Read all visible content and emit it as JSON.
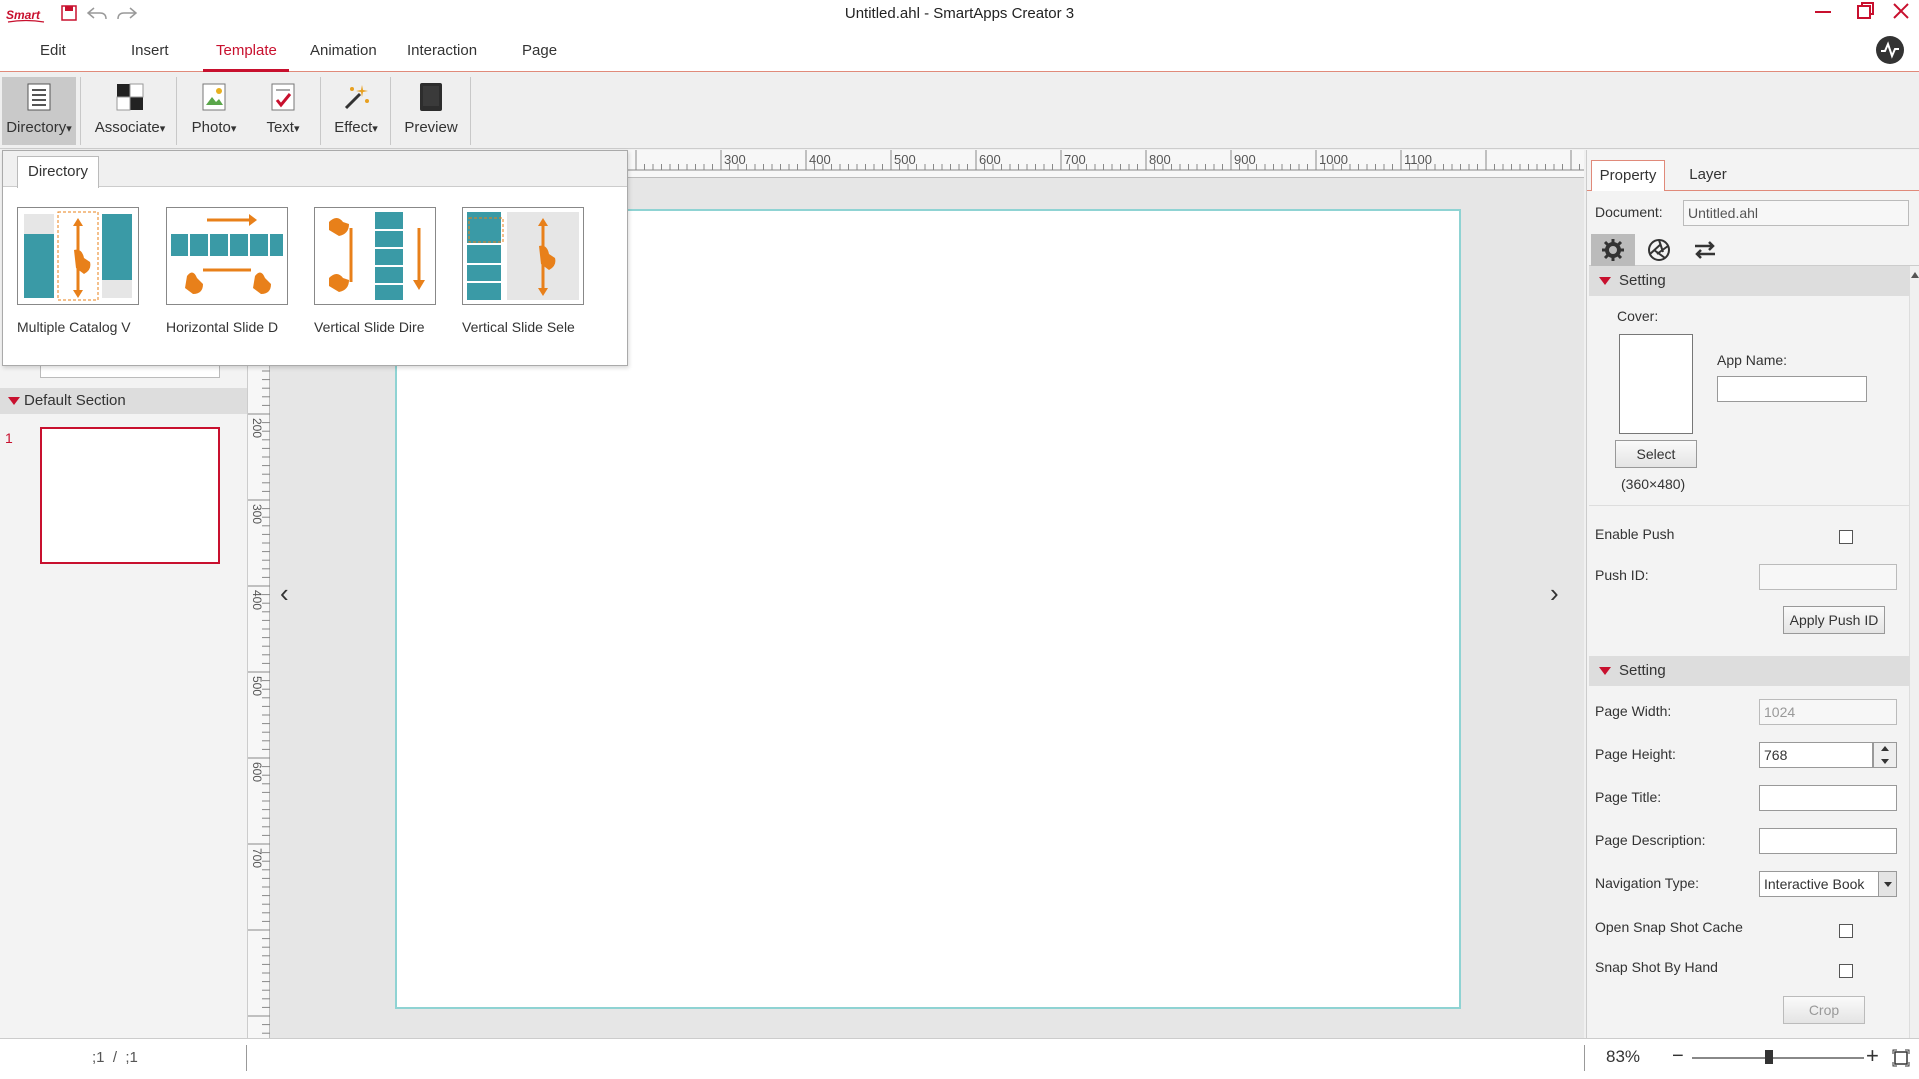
{
  "window": {
    "title": "Untitled.ahl - SmartApps Creator 3",
    "logo": "Smart"
  },
  "menu": {
    "items": [
      "Edit",
      "Insert",
      "Template",
      "Animation",
      "Interaction",
      "Page"
    ],
    "active": "Template"
  },
  "ribbon": {
    "buttons": [
      {
        "label": "Directory",
        "has_dropdown": true,
        "icon": "directory-icon"
      },
      {
        "label": "Associate",
        "has_dropdown": true,
        "icon": "associate-icon"
      },
      {
        "label": "Photo",
        "has_dropdown": true,
        "icon": "photo-icon"
      },
      {
        "label": "Text",
        "has_dropdown": true,
        "icon": "text-icon"
      },
      {
        "label": "Effect",
        "has_dropdown": true,
        "icon": "magic-wand-icon"
      },
      {
        "label": "Preview",
        "has_dropdown": false,
        "icon": "preview-icon"
      }
    ],
    "dropdown_glyph": "▾"
  },
  "directory_popup": {
    "tab": "Directory",
    "templates": [
      {
        "caption": "Multiple Catalog V"
      },
      {
        "caption": "Horizontal Slide D"
      },
      {
        "caption": "Vertical Slide Dire"
      },
      {
        "caption": "Vertical Slide Sele"
      }
    ]
  },
  "left_panel": {
    "section_title": "Default Section",
    "page_number": "1"
  },
  "ruler": {
    "horizontal_labels": [
      "300",
      "400",
      "500",
      "600",
      "700",
      "800",
      "900",
      "1000",
      "1100"
    ],
    "vertical_labels": [
      "200",
      "300",
      "400",
      "500",
      "600",
      "700"
    ]
  },
  "canvas": {
    "prev_arrow": "‹",
    "next_arrow": "›"
  },
  "right_panel": {
    "tabs": [
      "Property",
      "Layer"
    ],
    "active_tab": "Property",
    "document_label": "Document:",
    "document_value": "Untitled.ahl",
    "icon_tabs": [
      "gear-icon",
      "aperture-icon",
      "swap-icon"
    ],
    "setting1": {
      "title": "Setting",
      "cover_label": "Cover:",
      "app_name_label": "App Name:",
      "app_name_value": "",
      "select_button": "Select",
      "cover_size": "(360×480)",
      "enable_push_label": "Enable Push",
      "enable_push_checked": false,
      "push_id_label": "Push ID:",
      "push_id_value": "",
      "apply_push_button": "Apply Push ID"
    },
    "setting2": {
      "title": "Setting",
      "page_width_label": "Page Width:",
      "page_width_value": "1024",
      "page_height_label": "Page Height:",
      "page_height_value": "768",
      "page_title_label": "Page Title:",
      "page_title_value": "",
      "page_description_label": "Page Description:",
      "page_description_value": "",
      "navigation_type_label": "Navigation Type:",
      "navigation_type_value": "Interactive Book",
      "open_snapshot_label": "Open Snap Shot Cache",
      "open_snapshot_checked": false,
      "snapshot_hand_label": "Snap Shot By Hand",
      "snapshot_hand_checked": false,
      "crop_button": "Crop"
    }
  },
  "status_bar": {
    "page_indicator": ";1  /  ;1",
    "zoom": "83%",
    "zoom_level_fraction": 0.45
  },
  "colors": {
    "accent": "#c8102e",
    "template_teal": "#3a9aa6",
    "template_orange": "#e8801a"
  }
}
